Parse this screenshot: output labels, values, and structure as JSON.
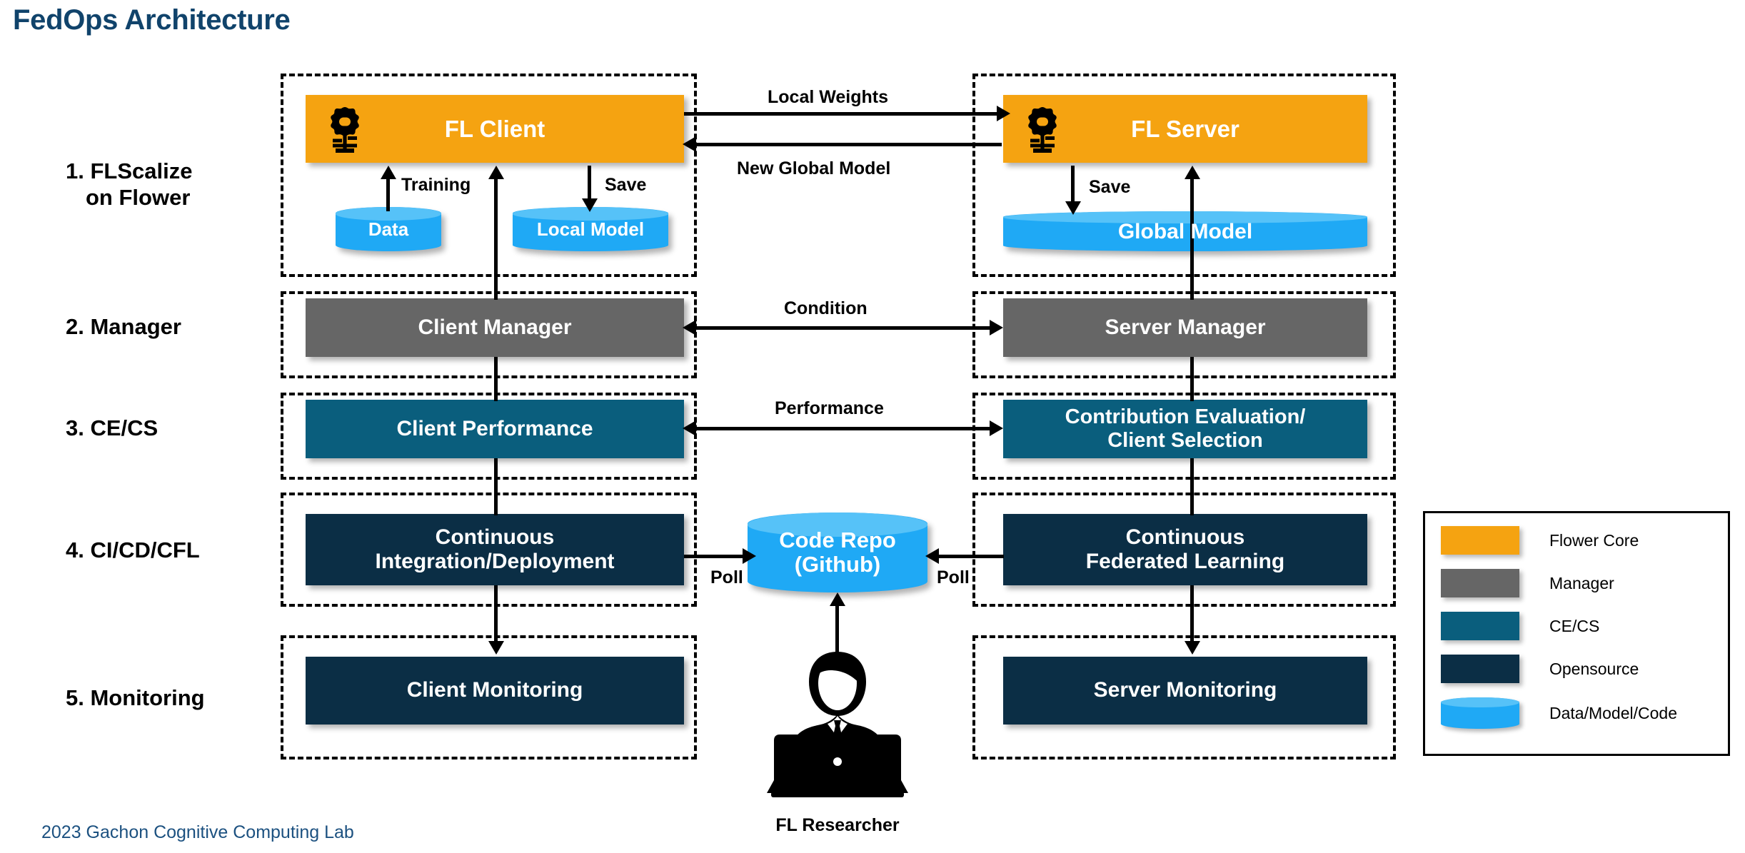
{
  "title": "FedOps Architecture",
  "footer": "2023 Gachon Cognitive Computing Lab",
  "row_labels": [
    {
      "line1": "1. FLScalize",
      "line2": "on Flower"
    },
    {
      "line1": "2. Manager",
      "line2": ""
    },
    {
      "line1": "3. CE/CS",
      "line2": ""
    },
    {
      "line1": "4. CI/CD/CFL",
      "line2": ""
    },
    {
      "line1": "5. Monitoring",
      "line2": ""
    }
  ],
  "client": {
    "fl_client": "FL Client",
    "data": "Data",
    "local_model": "Local Model",
    "training_label": "Training",
    "save_label": "Save",
    "manager": "Client Manager",
    "performance": "Client Performance",
    "cicd_line1": "Continuous",
    "cicd_line2": "Integration/Deployment",
    "monitoring": "Client Monitoring",
    "poll_label": "Poll"
  },
  "server": {
    "fl_server": "FL Server",
    "global_model": "Global Model",
    "save_label": "Save",
    "manager": "Server Manager",
    "cecs_line1": "Contribution Evaluation/",
    "cecs_line2": "Client Selection",
    "cfl_line1": "Continuous",
    "cfl_line2": "Federated Learning",
    "monitoring": "Server Monitoring",
    "poll_label": "Poll"
  },
  "center": {
    "local_weights": "Local Weights",
    "new_global_model": "New Global Model",
    "condition": "Condition",
    "performance": "Performance",
    "code_repo_line1": "Code Repo",
    "code_repo_line2": "(Github)",
    "researcher": "FL Researcher"
  },
  "legend": {
    "items": [
      {
        "label": "Flower Core",
        "color": "#F5A311",
        "shape": "rect"
      },
      {
        "label": "Manager",
        "color": "#666666",
        "shape": "rect"
      },
      {
        "label": "CE/CS",
        "color": "#0A5E7D",
        "shape": "rect"
      },
      {
        "label": "Opensource",
        "color": "#0B2E45",
        "shape": "rect"
      },
      {
        "label": "Data/Model/Code",
        "color": "#1FA9F5",
        "shape": "cylinder"
      }
    ]
  },
  "colors": {
    "title": "#10436B",
    "footer": "#1C5180",
    "flower_core": "#F5A311",
    "manager": "#666666",
    "cecs": "#0A5E7D",
    "opensource": "#0B2E45",
    "cylinder": "#1FA9F5",
    "cylinder_top": "#56C2F8"
  }
}
